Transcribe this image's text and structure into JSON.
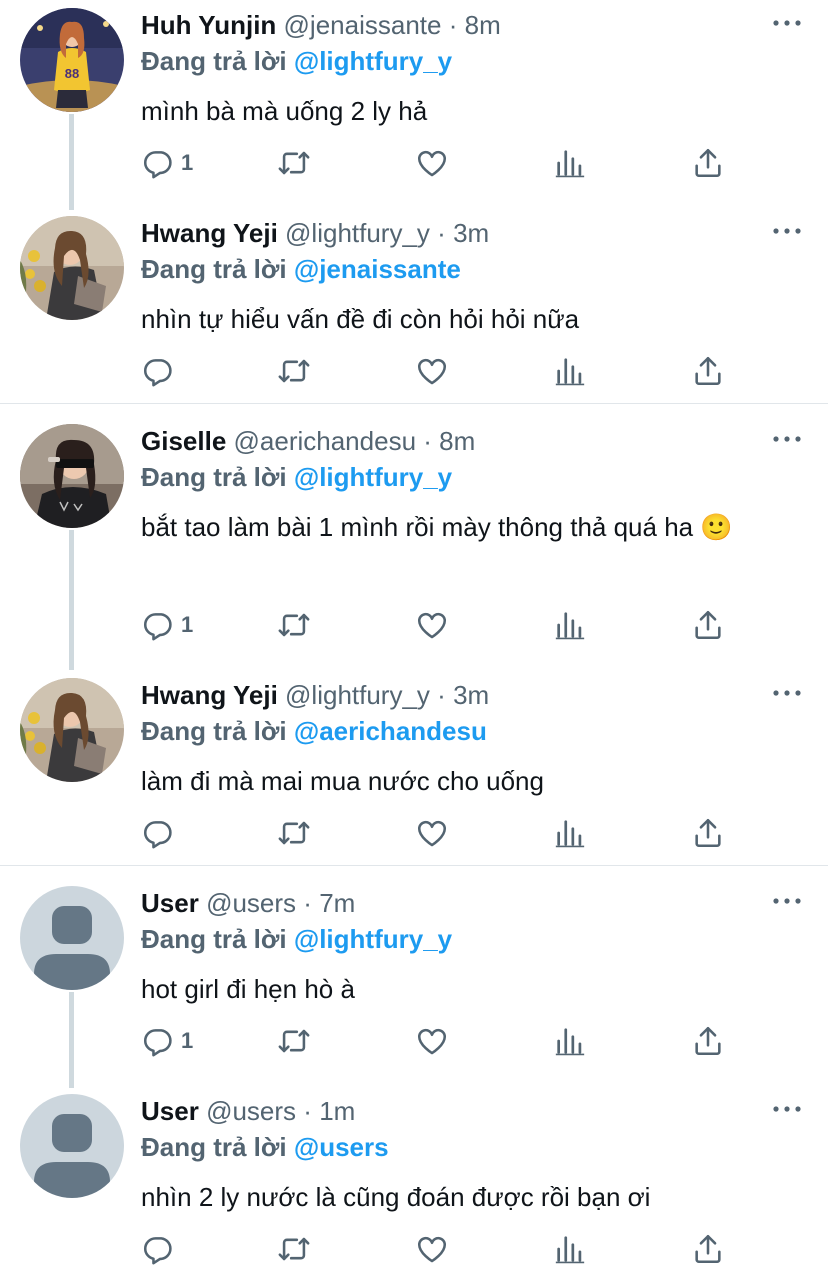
{
  "replying_label": "Đang trả lời",
  "colors": {
    "accent": "#1d9bf0",
    "secondary_text": "#536471",
    "thread_line": "#cfd9de"
  },
  "tweets": [
    {
      "name": "Huh Yunjin",
      "handle": "@jenaissante",
      "sep": "·",
      "time": "8m",
      "reply_to": "@lightfury_y",
      "text": "mình bà mà uống 2 ly hả",
      "reply_count": "1",
      "avatar": "yunjin-photo"
    },
    {
      "name": "Hwang Yeji",
      "handle": "@lightfury_y",
      "sep": "·",
      "time": "3m",
      "reply_to": "@jenaissante",
      "text": "nhìn tự hiểu vấn đề đi còn hỏi hỏi nữa",
      "reply_count": "",
      "avatar": "yeji-photo"
    },
    {
      "name": "Giselle",
      "handle": "@aerichandesu",
      "sep": "·",
      "time": "8m",
      "reply_to": "@lightfury_y",
      "text": "bắt tao làm bài 1 mình rồi mày thông thả quá ha 🙂",
      "reply_count": "1",
      "avatar": "giselle-photo"
    },
    {
      "name": "Hwang Yeji",
      "handle": "@lightfury_y",
      "sep": "·",
      "time": "3m",
      "reply_to": "@aerichandesu",
      "text": "làm đi mà mai mua nước cho uống",
      "reply_count": "",
      "avatar": "yeji-photo"
    },
    {
      "name": "User",
      "handle": "@users",
      "sep": "·",
      "time": "7m",
      "reply_to": "@lightfury_y",
      "text": "hot girl đi hẹn hò à",
      "reply_count": "1",
      "avatar": "default-avatar"
    },
    {
      "name": "User",
      "handle": "@users",
      "sep": "·",
      "time": "1m",
      "reply_to": "@users",
      "text": "nhìn 2 ly nước là cũng đoán được rồi bạn ơi",
      "reply_count": "",
      "avatar": "default-avatar"
    }
  ]
}
